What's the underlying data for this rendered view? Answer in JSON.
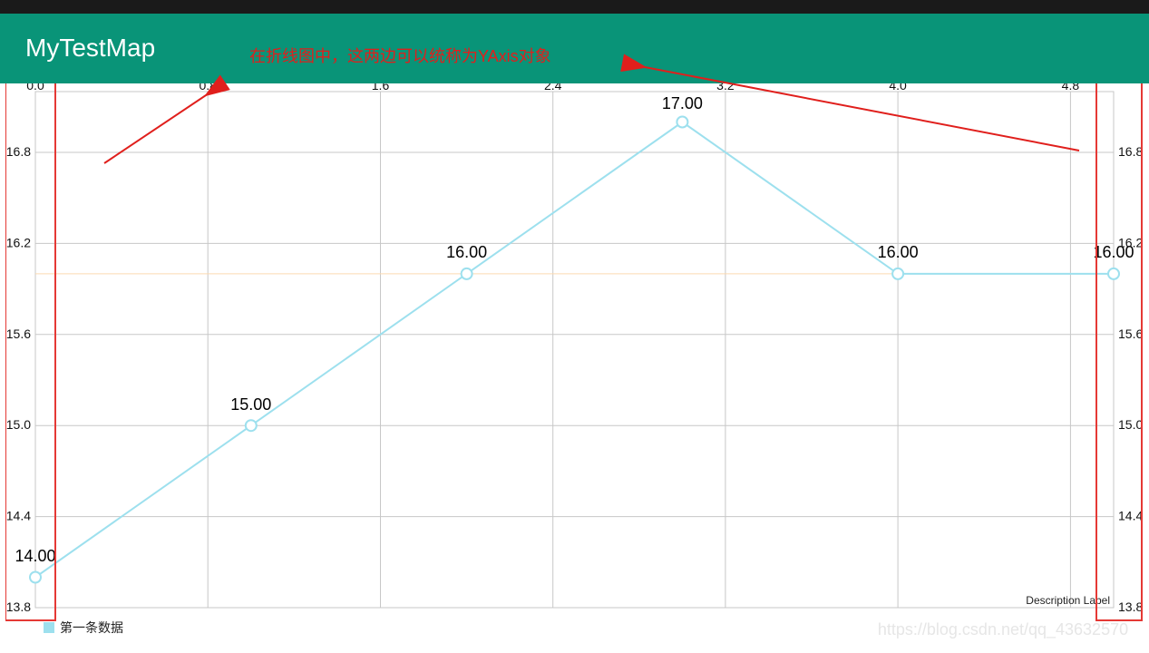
{
  "statusbar": {},
  "appbar": {
    "title": "MyTestMap"
  },
  "annotation": {
    "text": "在折线图中，这两边可以统称为YAxis对象"
  },
  "chart_data": {
    "type": "line",
    "x": [
      0,
      1,
      2,
      3,
      4,
      5
    ],
    "values": [
      14.0,
      15.0,
      16.0,
      17.0,
      16.0,
      16.0
    ],
    "value_labels": [
      "14.00",
      "15.00",
      "16.00",
      "17.00",
      "16.00",
      "16.00"
    ],
    "xticks": [
      "0.0",
      "0.8",
      "1.6",
      "2.4",
      "3.2",
      "4.0",
      "4.8"
    ],
    "yticks": [
      "13.8",
      "14.4",
      "15.0",
      "15.6",
      "16.2",
      "16.8"
    ],
    "xlim": [
      0.0,
      5.0
    ],
    "ylim": [
      13.8,
      17.2
    ],
    "title": "",
    "xlabel": "",
    "ylabel": "",
    "series_name": "第一条数据",
    "description": "Description Label",
    "average_line_y": 16.0,
    "line_color": "#9de0ee",
    "grid": true,
    "legend_position": "bottom-left"
  },
  "watermark": "https://blog.csdn.net/qq_43632570"
}
